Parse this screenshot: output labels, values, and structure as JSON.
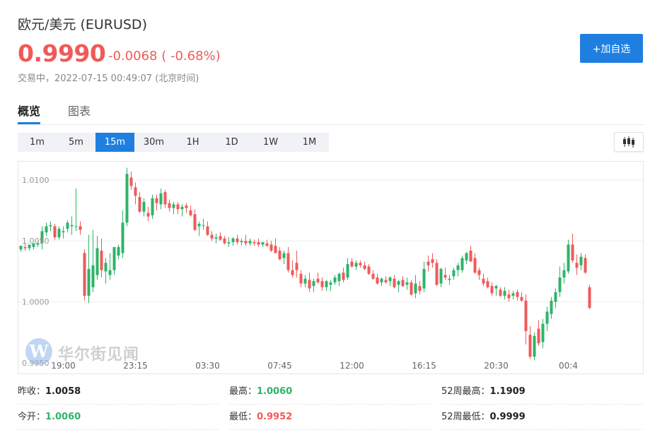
{
  "header": {
    "title": "欧元/美元  (EURUSD)",
    "price": "0.9990",
    "change": "-0.0068 ( -0.68%)",
    "status": "交易中，2022-07-15 00:49:07 (北京时间)",
    "add_button": "+加自选"
  },
  "tabs": [
    {
      "label": "概览",
      "active": true
    },
    {
      "label": "图表",
      "active": false
    }
  ],
  "intervals": [
    {
      "label": "1m",
      "active": false
    },
    {
      "label": "5m",
      "active": false
    },
    {
      "label": "15m",
      "active": true
    },
    {
      "label": "30m",
      "active": false
    },
    {
      "label": "1H",
      "active": false
    },
    {
      "label": "1D",
      "active": false
    },
    {
      "label": "1W",
      "active": false
    },
    {
      "label": "1M",
      "active": false
    }
  ],
  "chart_toggle_icon": "candlestick-icon",
  "watermark": {
    "logo_letter": "W",
    "text": "华尔街见闻"
  },
  "colors": {
    "up": "#2fb36a",
    "down": "#f05a5a",
    "accent": "#1e7fe0"
  },
  "chart_data": {
    "type": "candlestick",
    "ylim": [
      0.9947,
      1.0115
    ],
    "y_ticks": [
      "1.0100",
      "1.0050",
      "1.0000",
      "0.9950"
    ],
    "y_tick_values": [
      1.01,
      1.005,
      1.0,
      0.995
    ],
    "x_ticks": [
      "19:00",
      "23:15",
      "03:30",
      "07:45",
      "12:00",
      "16:15",
      "20:30",
      "00:4"
    ],
    "x_tick_index": [
      10,
      27,
      44,
      61,
      78,
      95,
      112,
      129
    ],
    "candles": [
      [
        1.0043,
        1.0046,
        1.0041,
        1.0046
      ],
      [
        1.0045,
        1.0048,
        1.0042,
        1.0044
      ],
      [
        1.0044,
        1.0046,
        1.0042,
        1.0047
      ],
      [
        1.0045,
        1.0048,
        1.0043,
        1.0048
      ],
      [
        1.0047,
        1.005,
        1.0045,
        1.0048
      ],
      [
        1.0048,
        1.0062,
        1.0043,
        1.0058
      ],
      [
        1.0057,
        1.0065,
        1.0054,
        1.0062
      ],
      [
        1.0062,
        1.0066,
        1.0058,
        1.0063
      ],
      [
        1.0062,
        1.0064,
        1.0051,
        1.0053
      ],
      [
        1.0053,
        1.0062,
        1.0051,
        1.006
      ],
      [
        1.0057,
        1.0062,
        1.0052,
        1.0058
      ],
      [
        1.006,
        1.0067,
        1.0057,
        1.0065
      ],
      [
        1.0062,
        1.007,
        1.0055,
        1.0063
      ],
      [
        1.0062,
        1.0093,
        1.0058,
        1.0062
      ],
      [
        1.0062,
        1.0066,
        1.0055,
        1.0059
      ],
      [
        1.004,
        1.0043,
        1.0001,
        1.0005
      ],
      [
        1.0005,
        1.0055,
        0.9999,
        1.0027
      ],
      [
        1.0012,
        1.0059,
        1.0008,
        1.003
      ],
      [
        1.0022,
        1.0054,
        1.0018,
        1.0044
      ],
      [
        1.0042,
        1.0052,
        1.002,
        1.0026
      ],
      [
        1.0025,
        1.0036,
        1.0015,
        1.0032
      ],
      [
        1.0022,
        1.004,
        1.0018,
        1.0026
      ],
      [
        1.0026,
        1.0045,
        1.0022,
        1.0045
      ],
      [
        1.0038,
        1.0047,
        1.0035,
        1.0045
      ],
      [
        1.004,
        1.0075,
        1.0036,
        1.0065
      ],
      [
        1.0065,
        1.011,
        1.0062,
        1.0105
      ],
      [
        1.0102,
        1.0107,
        1.0092,
        1.0095
      ],
      [
        1.0094,
        1.0098,
        1.008,
        1.0087
      ],
      [
        1.0086,
        1.009,
        1.0073,
        1.0074
      ],
      [
        1.0074,
        1.0085,
        1.007,
        1.0082
      ],
      [
        1.0073,
        1.0078,
        1.0066,
        1.007
      ],
      [
        1.0071,
        1.0088,
        1.0068,
        1.0085
      ],
      [
        1.0085,
        1.0088,
        1.0075,
        1.0081
      ],
      [
        1.008,
        1.0093,
        1.0076,
        1.0089
      ],
      [
        1.009,
        1.0092,
        1.0077,
        1.008
      ],
      [
        1.0081,
        1.0084,
        1.0074,
        1.0077
      ],
      [
        1.0077,
        1.0082,
        1.0072,
        1.008
      ],
      [
        1.008,
        1.0082,
        1.0072,
        1.0076
      ],
      [
        1.0076,
        1.008,
        1.007,
        1.0078
      ],
      [
        1.0079,
        1.0081,
        1.0073,
        1.0077
      ],
      [
        1.0075,
        1.0079,
        1.007,
        1.0071
      ],
      [
        1.0072,
        1.0076,
        1.0058,
        1.0059
      ],
      [
        1.0062,
        1.0066,
        1.0054,
        1.0064
      ],
      [
        1.0063,
        1.0068,
        1.0059,
        1.0063
      ],
      [
        1.0062,
        1.0066,
        1.0054,
        1.0055
      ],
      [
        1.0055,
        1.0058,
        1.005,
        1.0052
      ],
      [
        1.0052,
        1.0056,
        1.0048,
        1.0053
      ],
      [
        1.0054,
        1.0057,
        1.005,
        1.0051
      ],
      [
        1.0052,
        1.0054,
        1.0047,
        1.0048
      ],
      [
        1.0048,
        1.0053,
        1.0045,
        1.0049
      ],
      [
        1.0049,
        1.0053,
        1.0046,
        1.0052
      ],
      [
        1.0052,
        1.0055,
        1.0047,
        1.0049
      ],
      [
        1.0049,
        1.0052,
        1.0046,
        1.005
      ],
      [
        1.005,
        1.0055,
        1.0046,
        1.0048
      ],
      [
        1.0048,
        1.0052,
        1.0046,
        1.005
      ],
      [
        1.0049,
        1.0051,
        1.0046,
        1.0048
      ],
      [
        1.0049,
        1.0052,
        1.0045,
        1.0047
      ],
      [
        1.0047,
        1.0049,
        1.0045,
        1.0049
      ],
      [
        1.0048,
        1.0051,
        1.0045,
        1.0046
      ],
      [
        1.0047,
        1.005,
        1.0041,
        1.0042
      ],
      [
        1.0046,
        1.0052,
        1.004,
        1.004
      ],
      [
        1.0042,
        1.0045,
        1.0034,
        1.0035
      ],
      [
        1.0036,
        1.0042,
        1.0031,
        1.004
      ],
      [
        1.004,
        1.0045,
        1.0024,
        1.0026
      ],
      [
        1.0026,
        1.0034,
        1.002,
        1.0022
      ],
      [
        1.0032,
        1.0042,
        1.002,
        1.0026
      ],
      [
        1.0023,
        1.0026,
        1.0012,
        1.0015
      ],
      [
        1.0015,
        1.0022,
        1.0012,
        1.0019
      ],
      [
        1.0018,
        1.0024,
        1.0008,
        1.0011
      ],
      [
        1.0013,
        1.0019,
        1.0008,
        1.0017
      ],
      [
        1.0019,
        1.0024,
        1.0015,
        1.0016
      ],
      [
        1.0017,
        1.002,
        1.0009,
        1.0012
      ],
      [
        1.0012,
        1.0018,
        1.0009,
        1.0017
      ],
      [
        1.0014,
        1.0018,
        1.0009,
        1.0016
      ],
      [
        1.0016,
        1.0022,
        1.0014,
        1.002
      ],
      [
        1.0017,
        1.0024,
        1.0013,
        1.0023
      ],
      [
        1.0024,
        1.0028,
        1.0016,
        1.0018
      ],
      [
        1.002,
        1.0036,
        1.0018,
        1.0031
      ],
      [
        1.0033,
        1.0036,
        1.0028,
        1.0029
      ],
      [
        1.0029,
        1.0034,
        1.0026,
        1.0032
      ],
      [
        1.0032,
        1.0034,
        1.0028,
        1.003
      ],
      [
        1.003,
        1.0033,
        1.0026,
        1.0027
      ],
      [
        1.0029,
        1.0031,
        1.0022,
        1.0023
      ],
      [
        1.0023,
        1.0026,
        1.0018,
        1.0019
      ],
      [
        1.002,
        1.0023,
        1.0014,
        1.0015
      ],
      [
        1.0016,
        1.002,
        1.0013,
        1.0019
      ],
      [
        1.0018,
        1.0021,
        1.0015,
        1.0016
      ],
      [
        1.0017,
        1.0021,
        1.0013,
        1.002
      ],
      [
        1.0019,
        1.0022,
        1.0011,
        1.0012
      ],
      [
        1.0014,
        1.0018,
        1.0008,
        1.0017
      ],
      [
        1.0018,
        1.0021,
        1.0012,
        1.0013
      ],
      [
        1.0014,
        1.002,
        1.001,
        1.0016
      ],
      [
        1.0016,
        1.0018,
        1.0005,
        1.0006
      ],
      [
        1.0007,
        1.0022,
        1.0003,
        1.0015
      ],
      [
        1.0013,
        1.0017,
        1.0006,
        1.0009
      ],
      [
        1.0011,
        1.0033,
        1.0008,
        1.0027
      ],
      [
        1.0033,
        1.0038,
        1.0025,
        1.003
      ],
      [
        1.0035,
        1.004,
        1.0028,
        1.0032
      ],
      [
        1.0032,
        1.0035,
        1.0013,
        1.0014
      ],
      [
        1.0015,
        1.0028,
        1.0012,
        1.0027
      ],
      [
        1.0022,
        1.0028,
        1.0018,
        1.002
      ],
      [
        1.0018,
        1.0022,
        1.0014,
        1.0019
      ],
      [
        1.0021,
        1.0028,
        1.0018,
        1.0026
      ],
      [
        1.0026,
        1.0032,
        1.0021,
        1.003
      ],
      [
        1.0026,
        1.0038,
        1.0024,
        1.0036
      ],
      [
        1.0034,
        1.0041,
        1.0031,
        1.004
      ],
      [
        1.0042,
        1.0046,
        1.0033,
        1.0033
      ],
      [
        1.0036,
        1.004,
        1.0023,
        1.0024
      ],
      [
        1.0026,
        1.0028,
        1.0018,
        1.0022
      ],
      [
        1.0019,
        1.0023,
        1.0013,
        1.0015
      ],
      [
        1.0017,
        1.002,
        1.0011,
        1.0012
      ],
      [
        1.0013,
        1.0016,
        1.0005,
        1.0007
      ],
      [
        1.0011,
        1.0014,
        1.0005,
        1.0013
      ],
      [
        1.001,
        1.0012,
        1.0004,
        1.0005
      ],
      [
        1.0005,
        1.0012,
        1.0002,
        1.0009
      ],
      [
        1.0006,
        1.001,
        1.0,
        1.0003
      ],
      [
        1.0005,
        1.0009,
        1.0002,
        1.0007
      ],
      [
        1.0008,
        1.001,
        1.0001,
        1.0004
      ],
      [
        1.0004,
        1.0008,
        1.0,
        1.0001
      ],
      [
        1.0001,
        1.0006,
        0.9965,
        0.9976
      ],
      [
        0.9973,
        0.998,
        0.9953,
        0.9955
      ],
      [
        0.9955,
        0.9975,
        0.9952,
        0.9972
      ],
      [
        0.9978,
        0.9985,
        0.9964,
        0.9966
      ],
      [
        0.9967,
        0.9986,
        0.9962,
        0.9982
      ],
      [
        0.9982,
        0.9996,
        0.9976,
        0.9992
      ],
      [
        0.999,
        1.0004,
        0.9986,
        1.0001
      ],
      [
        1.0,
        1.0011,
        0.9995,
        1.0008
      ],
      [
        1.0008,
        1.0029,
        1.0004,
        1.002
      ],
      [
        1.002,
        1.0032,
        1.0015,
        1.0026
      ],
      [
        1.0025,
        1.0051,
        1.0023,
        1.0047
      ],
      [
        1.0047,
        1.0056,
        1.0032,
        1.0034
      ],
      [
        1.0032,
        1.0039,
        1.0022,
        1.0028
      ],
      [
        1.003,
        1.004,
        1.0026,
        1.0037
      ],
      [
        1.0036,
        1.0039,
        1.0023,
        1.0024
      ],
      [
        1.0012,
        1.0014,
        0.9994,
        0.9995
      ]
    ]
  },
  "stats": [
    {
      "label": "昨收：",
      "value": "1.0058",
      "color": "black"
    },
    {
      "label": "最高：",
      "value": "1.0060",
      "color": "green"
    },
    {
      "label": "52周最高：",
      "value": "1.1909",
      "color": "black"
    },
    {
      "label": "今开：",
      "value": "1.0060",
      "color": "green"
    },
    {
      "label": "最低：",
      "value": "0.9952",
      "color": "red"
    },
    {
      "label": "52周最低：",
      "value": "0.9999",
      "color": "black"
    }
  ]
}
